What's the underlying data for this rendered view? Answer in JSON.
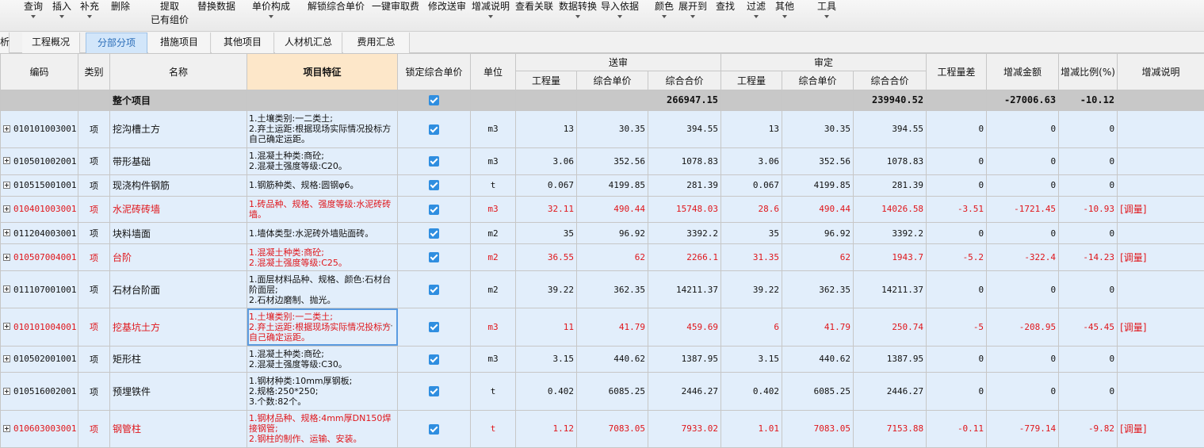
{
  "toolbar": {
    "items": [
      "查询",
      "插入",
      "补充",
      "删除",
      "提取",
      "替换数据",
      "单价构成",
      "解锁综合单价",
      "一键审取费",
      "修改送审",
      "增减说明",
      "查看关联",
      "数据转换",
      "导入依据",
      "颜色",
      "展开到",
      "查找",
      "过滤",
      "其他",
      "工具"
    ],
    "sub_label": "已有组价"
  },
  "tabs": [
    "析",
    "工程概况",
    "分部分项",
    "措施项目",
    "其他项目",
    "人材机汇总",
    "费用汇总"
  ],
  "headers": {
    "code": "编码",
    "type": "类别",
    "name": "名称",
    "feature": "项目特征",
    "lock": "锁定综合单价",
    "unit": "单位",
    "submitted": "送审",
    "approved": "审定",
    "qty": "工程量",
    "unit_price": "综合单价",
    "total_price": "综合合价",
    "qty_diff": "工程量差",
    "inc_amount": "增减金额",
    "inc_ratio": "增减比例(%)",
    "inc_note": "增减说明"
  },
  "total_row": {
    "name": "整个项目",
    "sub_total": "266947.15",
    "app_total": "239940.52",
    "inc_amount": "-27006.63",
    "inc_ratio": "-10.12"
  },
  "rows": [
    {
      "code": "010101003001",
      "type": "项",
      "name": "挖沟槽土方",
      "feature": "1.土壤类别:一二类土;\n2.弃土运距:根据现场实际情况投标方自己确定运距。",
      "unit": "m3",
      "s_qty": "13",
      "s_price": "30.35",
      "s_total": "394.55",
      "a_qty": "13",
      "a_price": "30.35",
      "a_total": "394.55",
      "diff": "0",
      "amt": "0",
      "ratio": "0",
      "note": ""
    },
    {
      "code": "010501002001",
      "type": "项",
      "name": "带形基础",
      "feature": "1.混凝土种类:商砼;\n2.混凝土强度等级:C20。",
      "unit": "m3",
      "s_qty": "3.06",
      "s_price": "352.56",
      "s_total": "1078.83",
      "a_qty": "3.06",
      "a_price": "352.56",
      "a_total": "1078.83",
      "diff": "0",
      "amt": "0",
      "ratio": "0",
      "note": ""
    },
    {
      "code": "010515001001",
      "type": "项",
      "name": "现浇构件钢筋",
      "feature": "1.钢筋种类、规格:圆钢φ6。",
      "unit": "t",
      "s_qty": "0.067",
      "s_price": "4199.85",
      "s_total": "281.39",
      "a_qty": "0.067",
      "a_price": "4199.85",
      "a_total": "281.39",
      "diff": "0",
      "amt": "0",
      "ratio": "0",
      "note": ""
    },
    {
      "code": "010401003001",
      "type": "项",
      "name": "水泥砖砖墙",
      "feature": "1.砖品种、规格、强度等级:水泥砖砖墙。",
      "unit": "m3",
      "s_qty": "32.11",
      "s_price": "490.44",
      "s_total": "15748.03",
      "a_qty": "28.6",
      "a_price": "490.44",
      "a_total": "14026.58",
      "diff": "-3.51",
      "amt": "-1721.45",
      "ratio": "-10.93",
      "note": "[调量]"
    },
    {
      "code": "011204003001",
      "type": "项",
      "name": "块料墙面",
      "feature": "1.墙体类型:水泥砖外墙贴面砖。",
      "unit": "m2",
      "s_qty": "35",
      "s_price": "96.92",
      "s_total": "3392.2",
      "a_qty": "35",
      "a_price": "96.92",
      "a_total": "3392.2",
      "diff": "0",
      "amt": "0",
      "ratio": "0",
      "note": ""
    },
    {
      "code": "010507004001",
      "type": "项",
      "name": "台阶",
      "feature": "1.混凝土种类:商砼;\n2.混凝土强度等级:C25。",
      "unit": "m2",
      "s_qty": "36.55",
      "s_price": "62",
      "s_total": "2266.1",
      "a_qty": "31.35",
      "a_price": "62",
      "a_total": "1943.7",
      "diff": "-5.2",
      "amt": "-322.4",
      "ratio": "-14.23",
      "note": "[调量]"
    },
    {
      "code": "011107001001",
      "type": "项",
      "name": "石材台阶面",
      "feature": "1.面层材料品种、规格、颜色:石材台阶面层;\n2.石材边磨制、抛光。",
      "unit": "m2",
      "s_qty": "39.22",
      "s_price": "362.35",
      "s_total": "14211.37",
      "a_qty": "39.22",
      "a_price": "362.35",
      "a_total": "14211.37",
      "diff": "0",
      "amt": "0",
      "ratio": "0",
      "note": ""
    },
    {
      "code": "010101004001",
      "type": "项",
      "name": "挖基坑土方",
      "feature": "1.土壤类别:一二类土;\n2.弃土运距:根据现场实际情况投标方自己确定运距。",
      "unit": "m3",
      "s_qty": "11",
      "s_price": "41.79",
      "s_total": "459.69",
      "a_qty": "6",
      "a_price": "41.79",
      "a_total": "250.74",
      "diff": "-5",
      "amt": "-208.95",
      "ratio": "-45.45",
      "note": "[调量]"
    },
    {
      "code": "010502001001",
      "type": "项",
      "name": "矩形柱",
      "feature": "1.混凝土种类:商砼;\n2.混凝土强度等级:C30。",
      "unit": "m3",
      "s_qty": "3.15",
      "s_price": "440.62",
      "s_total": "1387.95",
      "a_qty": "3.15",
      "a_price": "440.62",
      "a_total": "1387.95",
      "diff": "0",
      "amt": "0",
      "ratio": "0",
      "note": ""
    },
    {
      "code": "010516002001",
      "type": "项",
      "name": "预埋铁件",
      "feature": "1.钢材种类:10mm厚钢板;\n2.规格:250*250;\n3.个数:82个。",
      "unit": "t",
      "s_qty": "0.402",
      "s_price": "6085.25",
      "s_total": "2446.27",
      "a_qty": "0.402",
      "a_price": "6085.25",
      "a_total": "2446.27",
      "diff": "0",
      "amt": "0",
      "ratio": "0",
      "note": ""
    },
    {
      "code": "010603003001",
      "type": "项",
      "name": "钢管柱",
      "feature": "1.钢材品种、规格:4mm厚DN150焊接钢管;\n2.钢柱的制作、运输、安装。",
      "unit": "t",
      "s_qty": "1.12",
      "s_price": "7083.05",
      "s_total": "7933.02",
      "a_qty": "1.01",
      "a_price": "7083.05",
      "a_total": "7153.88",
      "diff": "-0.11",
      "amt": "-779.14",
      "ratio": "-9.82",
      "note": "[调量]"
    }
  ],
  "colors": {
    "changed_row_text": "#e0161b",
    "active_tab": "#d2e6fa",
    "highlight_header": "#fde7c9",
    "row_bg": "#e2eefb",
    "total_bg": "#c8c8c8"
  }
}
